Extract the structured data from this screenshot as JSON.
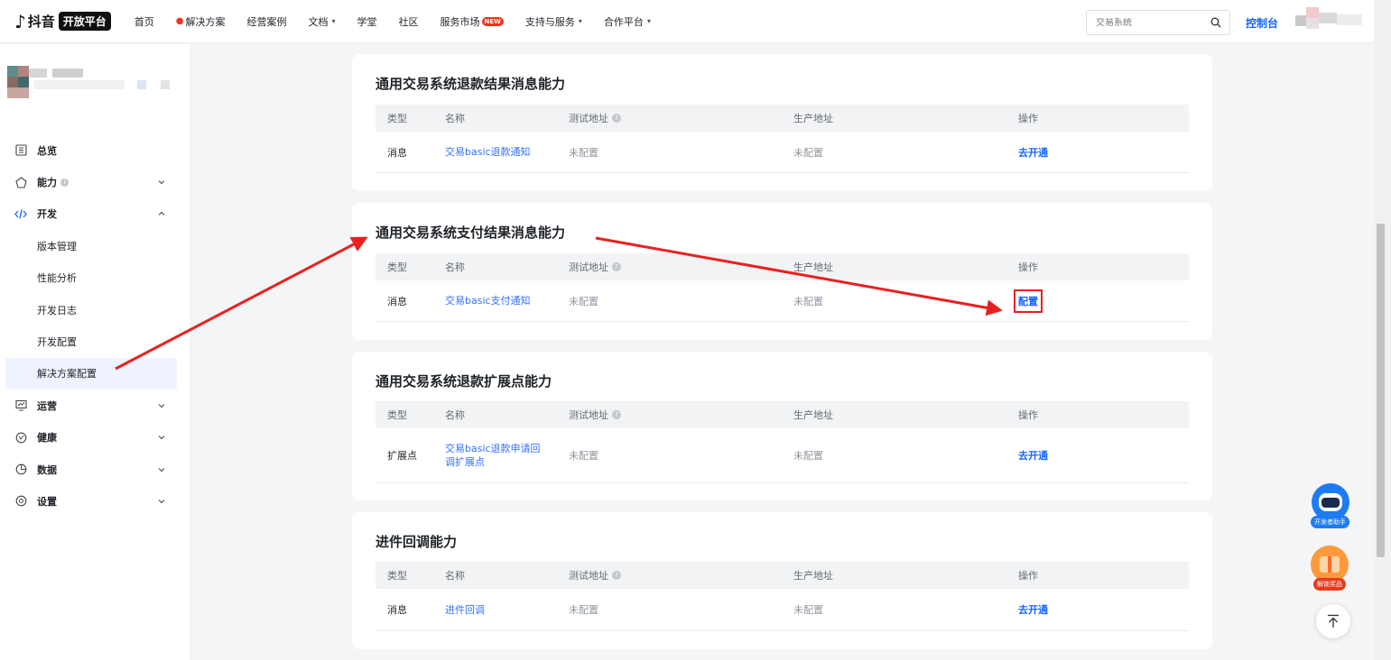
{
  "header": {
    "logo_text": "抖音",
    "logo_badge": "开放平台",
    "nav": [
      {
        "label": "首页",
        "fire": false,
        "caret": false,
        "badge": ""
      },
      {
        "label": "解决方案",
        "fire": true,
        "caret": false,
        "badge": ""
      },
      {
        "label": "经营案例",
        "fire": false,
        "caret": false,
        "badge": ""
      },
      {
        "label": "文档",
        "fire": false,
        "caret": true,
        "badge": ""
      },
      {
        "label": "学堂",
        "fire": false,
        "caret": false,
        "badge": ""
      },
      {
        "label": "社区",
        "fire": false,
        "caret": false,
        "badge": ""
      },
      {
        "label": "服务市场",
        "fire": false,
        "caret": false,
        "badge": "NEW"
      },
      {
        "label": "支持与服务",
        "fire": false,
        "caret": true,
        "badge": ""
      },
      {
        "label": "合作平台",
        "fire": false,
        "caret": true,
        "badge": ""
      }
    ],
    "search_placeholder": "交易系统",
    "console_label": "控制台"
  },
  "sidebar": {
    "items": [
      {
        "label": "总览",
        "icon": "dashboard-icon",
        "chevron": "",
        "info": false
      },
      {
        "label": "能力",
        "icon": "ability-icon",
        "chevron": "down",
        "info": true
      },
      {
        "label": "开发",
        "icon": "code-icon",
        "chevron": "up",
        "info": false
      },
      {
        "label": "运营",
        "icon": "operation-icon",
        "chevron": "down",
        "info": false
      },
      {
        "label": "健康",
        "icon": "health-icon",
        "chevron": "down",
        "info": false
      },
      {
        "label": "数据",
        "icon": "data-icon",
        "chevron": "down",
        "info": false
      },
      {
        "label": "设置",
        "icon": "settings-icon",
        "chevron": "down",
        "info": false
      }
    ],
    "dev_subitems": [
      "版本管理",
      "性能分析",
      "开发日志",
      "开发配置",
      "解决方案配置"
    ],
    "active_subitem": "解决方案配置"
  },
  "table_headers": {
    "type": "类型",
    "name": "名称",
    "test_url": "测试地址",
    "prod_url": "生产地址",
    "action": "操作"
  },
  "cards": [
    {
      "title": "通用交易系统退款结果消息能力",
      "rows": [
        {
          "type": "消息",
          "name": "交易basic退款通知",
          "test_url": "未配置",
          "prod_url": "未配置",
          "action": "去开通"
        }
      ]
    },
    {
      "title": "通用交易系统支付结果消息能力",
      "rows": [
        {
          "type": "消息",
          "name": "交易basic支付通知",
          "test_url": "未配置",
          "prod_url": "未配置",
          "action": "配置"
        }
      ]
    },
    {
      "title": "通用交易系统退款扩展点能力",
      "rows": [
        {
          "type": "扩展点",
          "name": "交易basic退款申请回调扩展点",
          "test_url": "未配置",
          "prod_url": "未配置",
          "action": "去开通"
        }
      ]
    },
    {
      "title": "进件回调能力",
      "rows": [
        {
          "type": "消息",
          "name": "进件回调",
          "test_url": "未配置",
          "prod_url": "未配置",
          "action": "去开通"
        }
      ]
    }
  ],
  "floating": {
    "assistant_label": "开发者助手",
    "reward_label": "解锁奖品"
  },
  "colors": {
    "accent": "#1664ff",
    "link": "#3370ff",
    "annotation": "#ea2020",
    "new_badge": "#f2331b"
  }
}
